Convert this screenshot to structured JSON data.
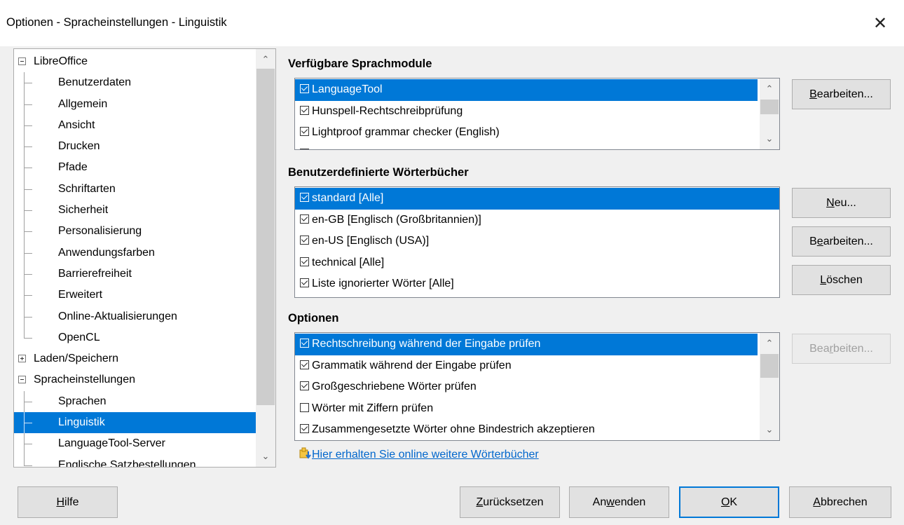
{
  "window": {
    "title": "Optionen - Spracheinstellungen - Linguistik"
  },
  "tree": {
    "items": [
      {
        "label": "LibreOffice",
        "level": 0,
        "expander": "minus"
      },
      {
        "label": "Benutzerdaten",
        "level": 1
      },
      {
        "label": "Allgemein",
        "level": 1
      },
      {
        "label": "Ansicht",
        "level": 1
      },
      {
        "label": "Drucken",
        "level": 1
      },
      {
        "label": "Pfade",
        "level": 1
      },
      {
        "label": "Schriftarten",
        "level": 1
      },
      {
        "label": "Sicherheit",
        "level": 1
      },
      {
        "label": "Personalisierung",
        "level": 1
      },
      {
        "label": "Anwendungsfarben",
        "level": 1
      },
      {
        "label": "Barrierefreiheit",
        "level": 1
      },
      {
        "label": "Erweitert",
        "level": 1
      },
      {
        "label": "Online-Aktualisierungen",
        "level": 1
      },
      {
        "label": "OpenCL",
        "level": 1
      },
      {
        "label": "Laden/Speichern",
        "level": 0,
        "expander": "plus"
      },
      {
        "label": "Spracheinstellungen",
        "level": 0,
        "expander": "minus"
      },
      {
        "label": "Sprachen",
        "level": 1
      },
      {
        "label": "Linguistik",
        "level": 1,
        "selected": true
      },
      {
        "label": "LanguageTool-Server",
        "level": 1
      },
      {
        "label": "Englische Satzbestellungen",
        "level": 1
      }
    ]
  },
  "modules": {
    "heading": "Verfügbare Sprachmodule",
    "items": [
      {
        "label": "LanguageTool",
        "checked": true,
        "selected": true
      },
      {
        "label": "Hunspell-Rechtschreibprüfung",
        "checked": true
      },
      {
        "label": "Lightproof grammar checker (English)",
        "checked": true
      },
      {
        "label": "",
        "checked": false
      }
    ],
    "edit_button": {
      "pre": "",
      "key": "B",
      "post": "earbeiten..."
    }
  },
  "dictionaries": {
    "heading": "Benutzerdefinierte Wörterbücher",
    "items": [
      {
        "label": "standard [Alle]",
        "checked": true,
        "selected": true
      },
      {
        "label": "en-GB [Englisch (Großbritannien)]",
        "checked": true
      },
      {
        "label": "en-US [Englisch (USA)]",
        "checked": true
      },
      {
        "label": "technical [Alle]",
        "checked": true
      },
      {
        "label": "Liste ignorierter Wörter [Alle]",
        "checked": true
      }
    ],
    "new_button": {
      "pre": "",
      "key": "N",
      "post": "eu..."
    },
    "edit_button": {
      "pre": "B",
      "key": "e",
      "post": "arbeiten..."
    },
    "delete_button": {
      "pre": "",
      "key": "L",
      "post": "öschen"
    }
  },
  "options": {
    "heading": "Optionen",
    "items": [
      {
        "label": "Rechtschreibung während der Eingabe prüfen",
        "checked": true,
        "selected": true
      },
      {
        "label": "Grammatik während der Eingabe prüfen",
        "checked": true
      },
      {
        "label": "Großgeschriebene Wörter prüfen",
        "checked": true
      },
      {
        "label": "Wörter mit Ziffern prüfen",
        "checked": false
      },
      {
        "label": "Zusammengesetzte Wörter ohne Bindestrich akzeptieren",
        "checked": true
      }
    ],
    "edit_button": {
      "pre": "Bea",
      "key": "r",
      "post": "beiten..."
    }
  },
  "link": {
    "label": "Hier erhalten Sie online weitere Wörterbücher"
  },
  "footer": {
    "help": {
      "pre": "",
      "key": "H",
      "post": "ilfe"
    },
    "reset": {
      "pre": "",
      "key": "Z",
      "post": "urücksetzen"
    },
    "apply": {
      "pre": "An",
      "key": "w",
      "post": "enden"
    },
    "ok": {
      "pre": "",
      "key": "O",
      "post": "K"
    },
    "cancel": {
      "pre": "",
      "key": "A",
      "post": "bbrechen"
    }
  },
  "scroll": {
    "tree_position": 0.0,
    "modules_position": 0.0,
    "options_position": 0.0
  },
  "colors": {
    "selection": "#0078d7",
    "link": "#0066cc",
    "default_border": "#0078d7"
  }
}
